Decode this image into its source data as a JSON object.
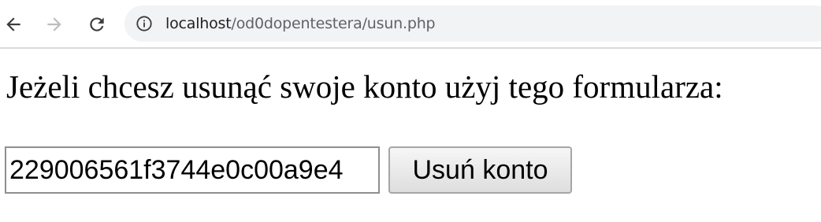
{
  "browser": {
    "url_host": "localhost",
    "url_path": "/od0dopentestera/usun.php",
    "icons": {
      "back": "arrow-left-icon",
      "forward": "arrow-right-icon",
      "reload": "reload-icon",
      "site_info": "info-icon"
    },
    "colors": {
      "forward_disabled": "#bdbdbd",
      "omnibox_bg": "#f1f3f4"
    }
  },
  "page": {
    "heading": "Jeżeli chcesz usunąć swoje konto użyj tego formularza:",
    "form": {
      "token_value": "229006561f3744e0c00a9e4",
      "submit_label": "Usuń konto"
    }
  }
}
